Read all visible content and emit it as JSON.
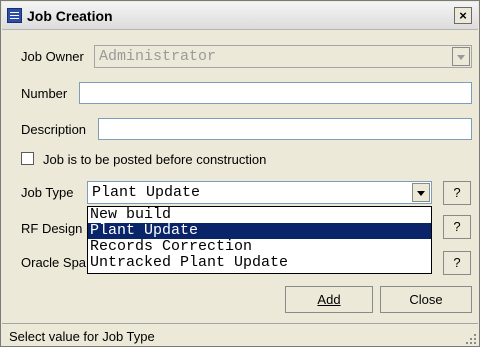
{
  "window": {
    "title": "Job Creation",
    "close_label": "×"
  },
  "fields": {
    "job_owner": {
      "label": "Job Owner",
      "value": "Administrator",
      "disabled": true
    },
    "number": {
      "label": "Number",
      "value": ""
    },
    "description": {
      "label": "Description",
      "value": ""
    },
    "posted_checkbox": {
      "label": "Job is to be posted before construction",
      "checked": false
    },
    "job_type": {
      "label": "Job Type",
      "value": "Plant Update"
    },
    "rf_design": {
      "label": "RF Design"
    },
    "oracle_space": {
      "label": "Oracle Spa"
    }
  },
  "help_label": "?",
  "job_type_options": [
    {
      "label": "New build",
      "selected": false
    },
    {
      "label": "Plant Update",
      "selected": true
    },
    {
      "label": "Records Correction",
      "selected": false
    },
    {
      "label": "Untracked Plant Update",
      "selected": false
    }
  ],
  "buttons": {
    "add": "Add",
    "close": "Close"
  },
  "status": {
    "text": "Select value for Job Type"
  },
  "icons": {
    "title": "window-icon",
    "dropdown": "chevron-down-icon",
    "grip": "resize-grip-icon"
  },
  "colors": {
    "selection": "#0a246a",
    "background": "#ece9d8",
    "field_border": "#7f9db9"
  }
}
